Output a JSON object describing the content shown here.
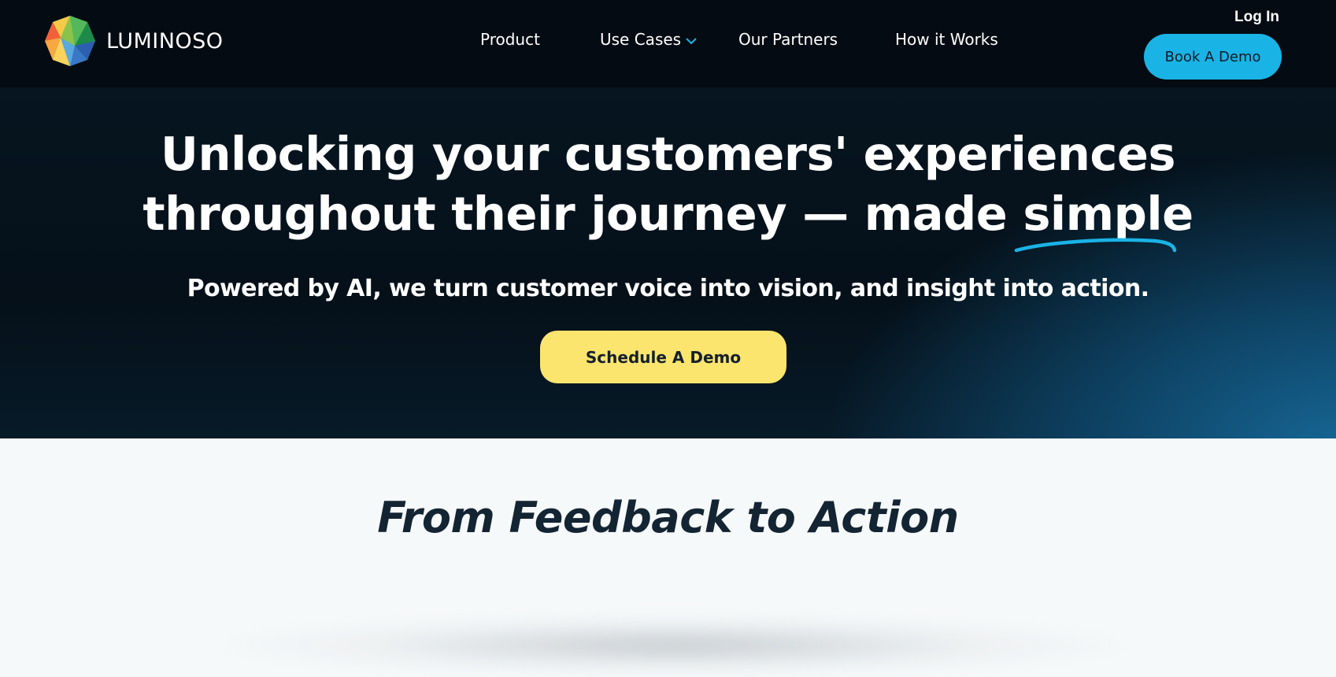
{
  "brand": {
    "name": "LUMINOSO",
    "logo_icon": "luminoso-gem-logo"
  },
  "nav": {
    "items": [
      {
        "label": "Product"
      },
      {
        "label": "Use Cases",
        "has_dropdown": true
      },
      {
        "label": "Our Partners"
      },
      {
        "label": "How it Works"
      }
    ],
    "login_label": "Log In",
    "book_demo_label": "Book A Demo"
  },
  "hero": {
    "headline_line1": "Unlocking your customers' experiences",
    "headline_line2_prefix": "throughout their journey — made ",
    "headline_highlight": "simple",
    "subheadline": "Powered by AI, we turn customer voice into vision, and insight into action.",
    "cta_label": "Schedule A Demo"
  },
  "section": {
    "title": "From Feedback to Action"
  },
  "colors": {
    "header_bg": "#050b12",
    "accent_blue": "#1ab3e6",
    "cta_yellow": "#fbe56e",
    "hero_glow": "#176999",
    "section_bg": "#f6f9fa",
    "section_title": "#132433"
  }
}
